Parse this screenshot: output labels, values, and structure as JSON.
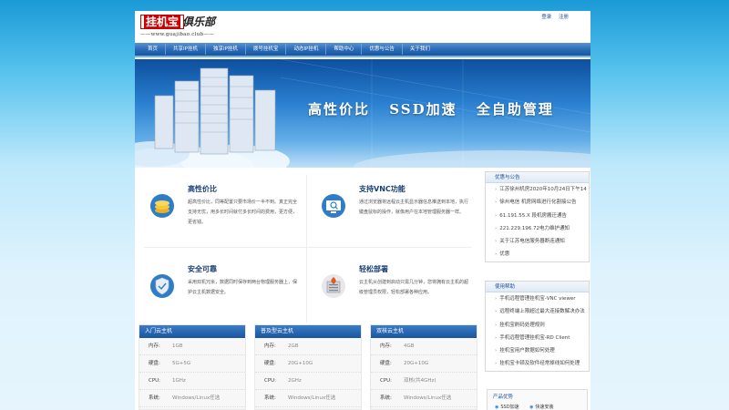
{
  "logo": {
    "brand": "挂机宝",
    "club": "俱乐部",
    "url": "——www.guajibao.club——"
  },
  "top_links": {
    "login": "登录",
    "register": "注册"
  },
  "nav": [
    "首页",
    "共享IP挂机",
    "独享IP挂机",
    "拨号挂机宝",
    "动态IP挂机",
    "帮助中心",
    "优惠与公告",
    "关于我们"
  ],
  "banner": {
    "slogan_1": "高性价比",
    "slogan_2": "SSD加速",
    "slogan_3": "全自助管理"
  },
  "features": [
    {
      "title": "高性价比",
      "desc": "超高性价比，同等配置只要市场价一半不到。真正完全支持无忧，用多长时间就付多长时间的费用，更方便，更省钱。",
      "icon": "coins-icon"
    },
    {
      "title": "支持VNC功能",
      "desc": "通过浏览器将远程云主机显示器信息推送到本地，执行键盘鼠标的操作，就像用户在本地管理服务器一样。",
      "icon": "monitor-search-icon"
    },
    {
      "title": "安全可靠",
      "desc": "采用双机冗余，数据同时保存到两台物理服务器上，保护云主机数据安全。",
      "icon": "shield-icon"
    },
    {
      "title": "轻松部署",
      "desc": "云主机从创建到启动只需几分钟，您将拥有云主机的超级管理员权限，轻松部署各种应用。",
      "icon": "server-fire-icon"
    }
  ],
  "plans": [
    {
      "name": "入门云主机",
      "rows": [
        [
          "内存:",
          "1GB"
        ],
        [
          "硬盘:",
          "5G+5G"
        ],
        [
          "CPU:",
          "1GHz"
        ],
        [
          "系统:",
          "Windows/Linux任选"
        ]
      ]
    },
    {
      "name": "普及型云主机",
      "rows": [
        [
          "内存:",
          "2GB"
        ],
        [
          "硬盘:",
          "20G+10G"
        ],
        [
          "CPU:",
          "2GHz"
        ],
        [
          "系统:",
          "Windows/Linux任选"
        ]
      ]
    },
    {
      "name": "双核云主机",
      "rows": [
        [
          "内存:",
          "4GB"
        ],
        [
          "硬盘:",
          "20G+10G"
        ],
        [
          "CPU:",
          "双核(共4GHz)"
        ],
        [
          "系统:",
          "Windows/Linux任选"
        ]
      ]
    }
  ],
  "sidebar": {
    "notice_title": "优惠与公告",
    "notices": [
      "江苏徐州机房2020年10月24日下午14",
      "徐州电信 机房网络进行化割接公告",
      "61.191.55.X 段机房搬迁通告",
      "221.229.196.72电力维护通知",
      "关于江苏电信服务器断连通知",
      "优惠"
    ],
    "help_title": "使用帮助",
    "help": [
      "手机远程管理挂机宝-VNC viewer",
      "远程终端上限超过最大连接数解决办法",
      "挂机宝刷码处理规则",
      "手机远程管理挂机宝-RD Client",
      "挂机宝用户数据如何处理",
      "挂机宝卡顿及软件经常掉线如何处理"
    ],
    "product_title": "产品优势",
    "product_items": [
      "SSD加速",
      "快速安装"
    ]
  },
  "colors": {
    "nav_blue": "#2a6bb8",
    "title_blue": "#1a3f77",
    "logo_red": "#cc0000"
  }
}
